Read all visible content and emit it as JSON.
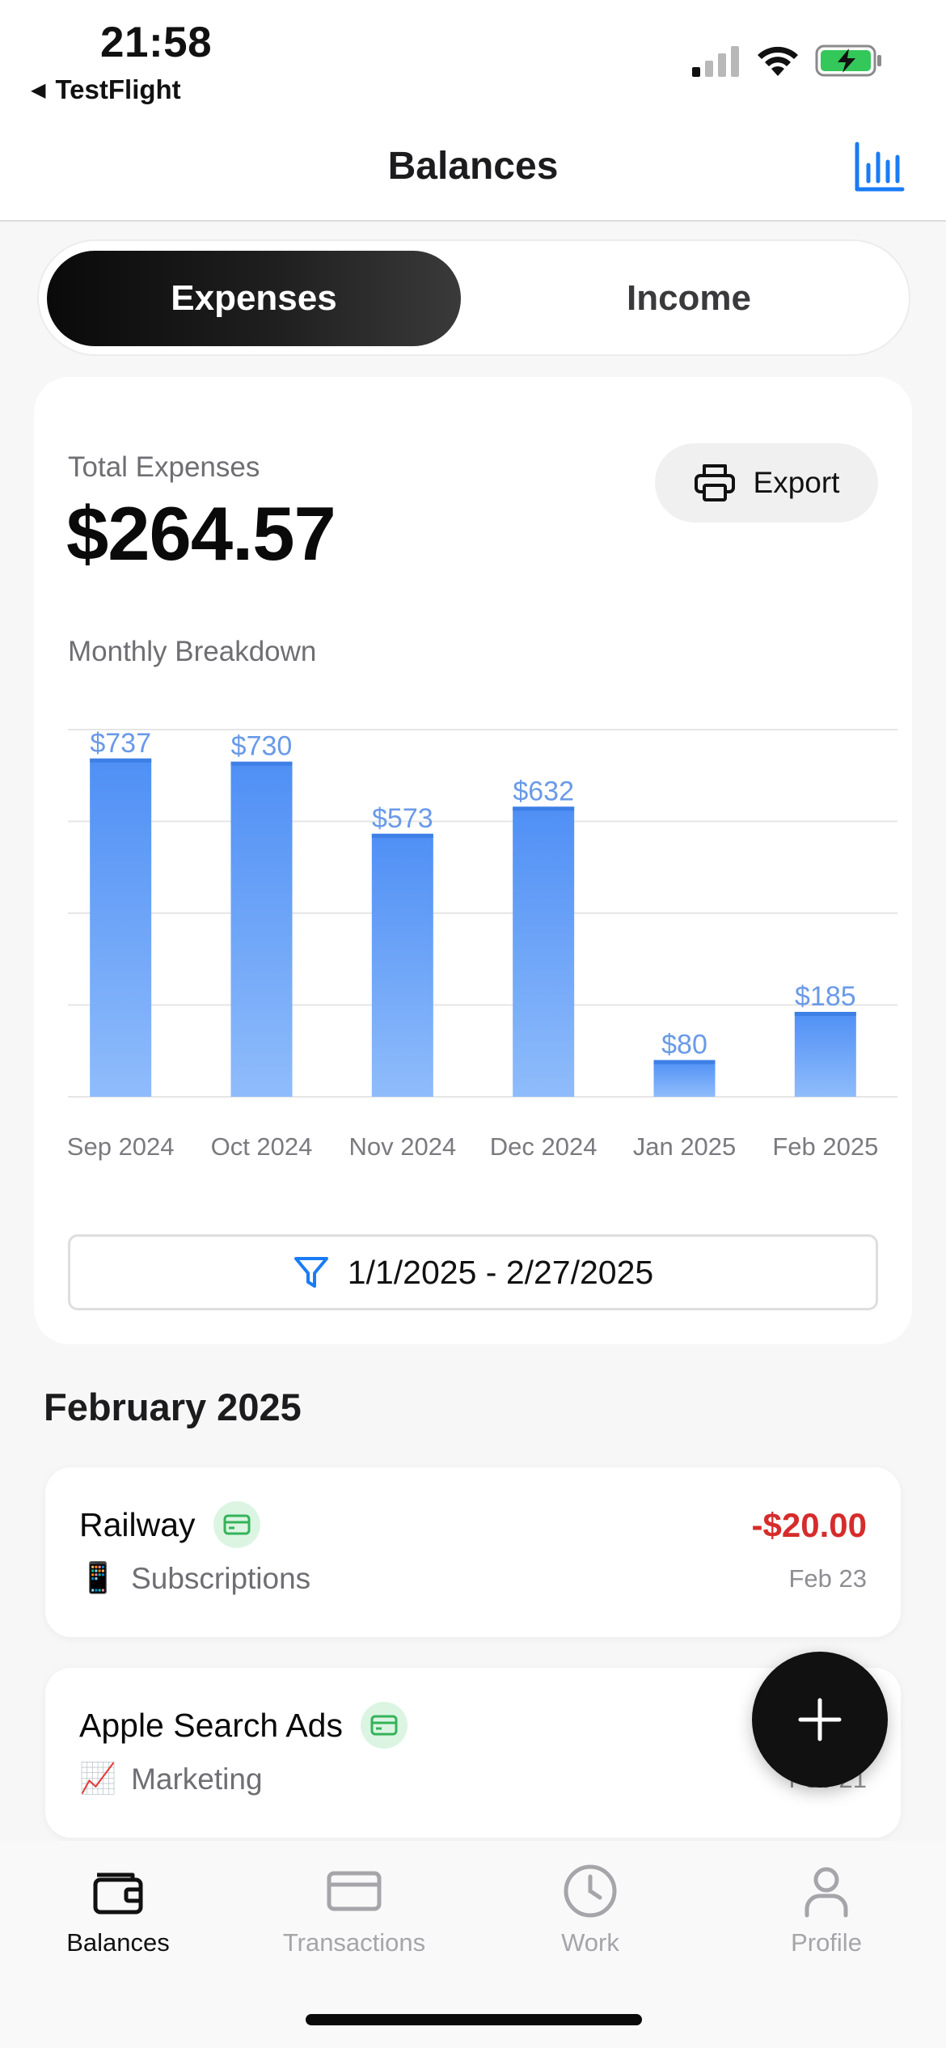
{
  "status_bar": {
    "time": "21:58",
    "back_app": "TestFlight"
  },
  "nav": {
    "title": "Balances"
  },
  "segmented": {
    "options": [
      "Expenses",
      "Income"
    ],
    "selected": "Expenses"
  },
  "summary": {
    "total_label": "Total Expenses",
    "total_amount": "$264.57",
    "export_label": "Export",
    "breakdown_label": "Monthly Breakdown",
    "date_filter": "1/1/2025 - 2/27/2025"
  },
  "chart_data": {
    "type": "bar",
    "categories": [
      "Sep 2024",
      "Oct 2024",
      "Nov 2024",
      "Dec 2024",
      "Jan 2025",
      "Feb 2025"
    ],
    "values": [
      737,
      730,
      573,
      632,
      80,
      185
    ],
    "value_labels": [
      "$737",
      "$730",
      "$573",
      "$632",
      "$80",
      "$185"
    ],
    "ylim": [
      0,
      800
    ],
    "grid": true,
    "bar_color_top": "#4f8ff5",
    "bar_color_bottom": "#8fbcfb",
    "label_color": "#6a9ae8"
  },
  "section": {
    "title": "February 2025"
  },
  "transactions": [
    {
      "name": "Railway",
      "category_emoji": "📱",
      "category": "Subscriptions",
      "amount": "-$20.00",
      "date": "Feb 23"
    },
    {
      "name": "Apple Search Ads",
      "category_emoji": "📈",
      "category": "Marketing",
      "amount": "",
      "date": "Feb 21"
    }
  ],
  "tabs": [
    {
      "label": "Balances",
      "icon": "wallet-icon",
      "active": true
    },
    {
      "label": "Transactions",
      "icon": "credit-card-icon",
      "active": false
    },
    {
      "label": "Work",
      "icon": "clock-icon",
      "active": false
    },
    {
      "label": "Profile",
      "icon": "person-icon",
      "active": false
    }
  ],
  "colors": {
    "accent_blue": "#1a7cf5",
    "negative_red": "#d62c2c",
    "card_badge_bg": "#dcf5e3",
    "card_badge_icon": "#34b35a"
  }
}
